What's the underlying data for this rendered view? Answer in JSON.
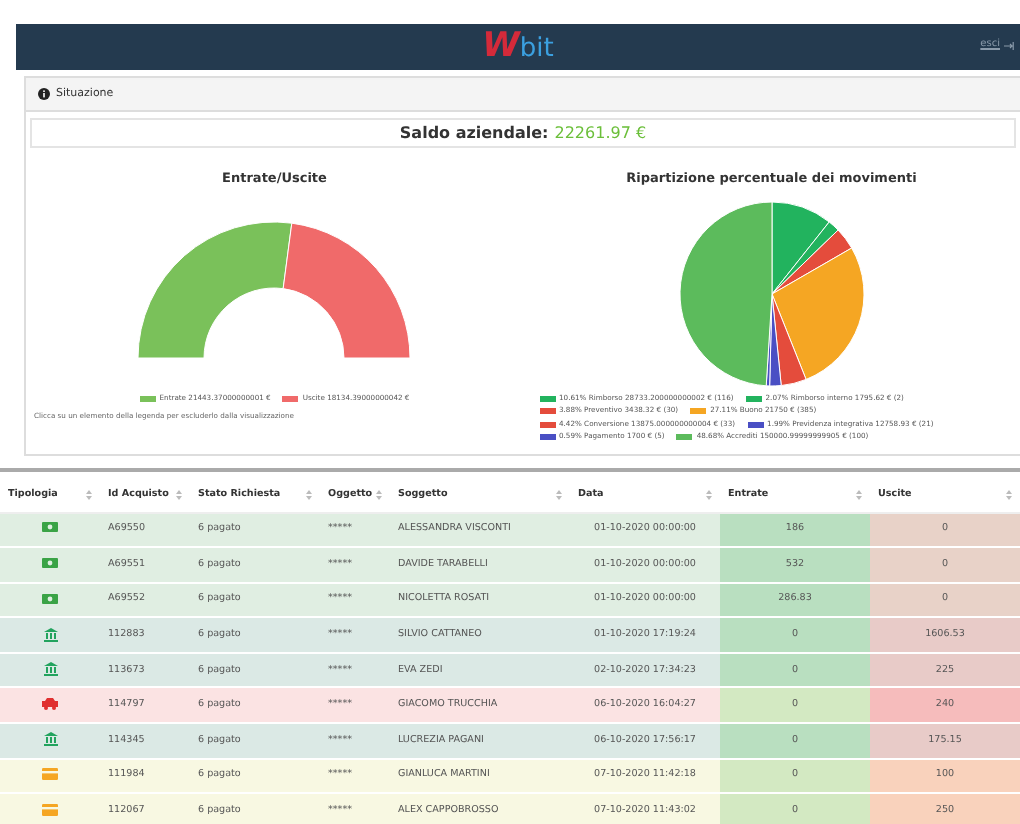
{
  "navbar": {
    "brand_mark": "W",
    "brand_text": "bit",
    "logout": "esci"
  },
  "panel": {
    "title": "Situazione"
  },
  "balance": {
    "label": "Saldo aziendale:",
    "value": "22261.97 €"
  },
  "charts": [
    {
      "note": "Clicca su un elemento della legenda per escluderlo dalla visualizzazione",
      "chart_data": {
        "type": "donut",
        "title": "Entrate/Uscite",
        "categories": [
          "Entrate 21443.37000000001 €",
          "Uscite 18134.39000000042 €"
        ],
        "values": [
          54.18,
          45.82
        ],
        "colors": [
          "#7ac15a",
          "#f06a6a"
        ],
        "legend": "bottom"
      }
    },
    {
      "chart_data": {
        "type": "pie",
        "title": "Ripartizione percentuale dei movimenti",
        "categories": [
          "10.61% Rimborso 28733.200000000002 € (116)",
          "2.07% Rimborso interno 1795.62 € (2)",
          "3.88% Preventivo 3438.32 € (30)",
          "27.11% Buono 21750 € (385)",
          "4.42% Conversione 13875.000000000004 € (33)",
          "1.99% Previdenza integrativa 12758.93 € (21)",
          "0.59% Pagamento 1700 € (5)",
          "48.68% Accrediti 150000.99999999905 € (100)"
        ],
        "values": [
          10.61,
          2.07,
          3.88,
          27.11,
          4.42,
          1.99,
          0.59,
          48.68
        ],
        "colors": [
          "#22b35e",
          "#22b35e",
          "#e44c3c",
          "#f5a623",
          "#e44c3c",
          "#4a4fc4",
          "#4a4fc4",
          "#5cbb5c"
        ],
        "legend": "bottom"
      }
    }
  ],
  "table": {
    "columns": [
      "Tipologia",
      "Id Acquisto",
      "Stato Richiesta",
      "Oggetto",
      "Soggetto",
      "Data",
      "Entrate",
      "Uscite"
    ],
    "rows": [
      {
        "kind": "cash",
        "id": "A69550",
        "status": "6 pagato",
        "object": "*****",
        "subject": "ALESSANDRA VISCONTI",
        "date": "01-10-2020 00:00:00",
        "in": "186",
        "out": "0"
      },
      {
        "kind": "cash",
        "id": "A69551",
        "status": "6 pagato",
        "object": "*****",
        "subject": "DAVIDE TARABELLI",
        "date": "01-10-2020 00:00:00",
        "in": "532",
        "out": "0"
      },
      {
        "kind": "cash",
        "id": "A69552",
        "status": "6 pagato",
        "object": "*****",
        "subject": "NICOLETTA ROSATI",
        "date": "01-10-2020 00:00:00",
        "in": "286.83",
        "out": "0"
      },
      {
        "kind": "bank",
        "id": "112883",
        "status": "6 pagato",
        "object": "*****",
        "subject": "SILVIO CATTANEO",
        "date": "01-10-2020 17:19:24",
        "in": "0",
        "out": "1606.53"
      },
      {
        "kind": "bank",
        "id": "113673",
        "status": "6 pagato",
        "object": "*****",
        "subject": "EVA ZEDI",
        "date": "02-10-2020 17:34:23",
        "in": "0",
        "out": "225"
      },
      {
        "kind": "car",
        "id": "114797",
        "status": "6 pagato",
        "object": "*****",
        "subject": "GIACOMO TRUCCHIA",
        "date": "06-10-2020 16:04:27",
        "in": "0",
        "out": "240"
      },
      {
        "kind": "bank",
        "id": "114345",
        "status": "6 pagato",
        "object": "*****",
        "subject": "LUCREZIA PAGANI",
        "date": "06-10-2020 17:56:17",
        "in": "0",
        "out": "175.15"
      },
      {
        "kind": "card",
        "id": "111984",
        "status": "6 pagato",
        "object": "*****",
        "subject": "GIANLUCA MARTINI",
        "date": "07-10-2020 11:42:18",
        "in": "0",
        "out": "100"
      },
      {
        "kind": "card",
        "id": "112067",
        "status": "6 pagato",
        "object": "*****",
        "subject": "ALEX CAPPOBROSSO",
        "date": "07-10-2020 11:43:02",
        "in": "0",
        "out": "250"
      }
    ]
  }
}
